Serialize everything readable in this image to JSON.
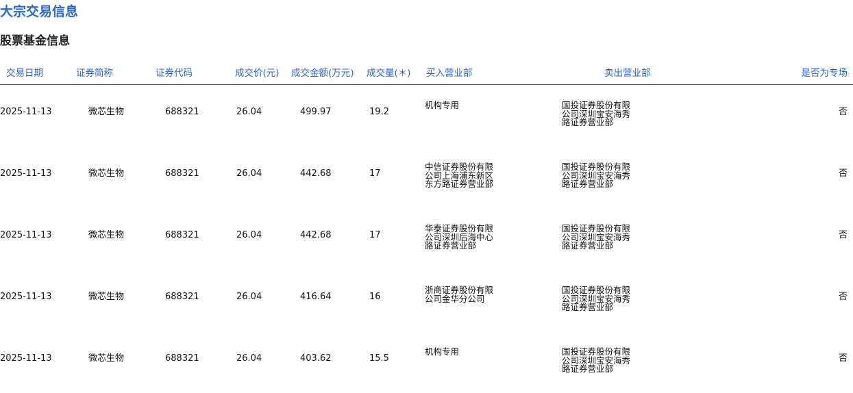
{
  "page": {
    "title": "大宗交易信息",
    "section_title": "股票基金信息"
  },
  "table": {
    "headers": {
      "date": "交易日期",
      "name": "证券简称",
      "code": "证券代码",
      "price": "成交价(元)",
      "amount": "成交金额(万元)",
      "volume": "成交量(＊)",
      "buy": "买入营业部",
      "sell": "卖出营业部",
      "special": "是否为专场"
    },
    "rows": [
      {
        "date": "2025-11-13",
        "name": "微芯生物",
        "code": "688321",
        "price": "26.04",
        "amount": "499.97",
        "volume": "19.2",
        "buy": "机构专用",
        "sell": "国投证券股份有限公司深圳宝安海秀路证券营业部",
        "special": "否"
      },
      {
        "date": "2025-11-13",
        "name": "微芯生物",
        "code": "688321",
        "price": "26.04",
        "amount": "442.68",
        "volume": "17",
        "buy": "中信证券股份有限公司上海浦东新区东方路证券营业部",
        "sell": "国投证券股份有限公司深圳宝安海秀路证券营业部",
        "special": "否"
      },
      {
        "date": "2025-11-13",
        "name": "微芯生物",
        "code": "688321",
        "price": "26.04",
        "amount": "442.68",
        "volume": "17",
        "buy": "华泰证券股份有限公司深圳后海中心路证券营业部",
        "sell": "国投证券股份有限公司深圳宝安海秀路证券营业部",
        "special": "否"
      },
      {
        "date": "2025-11-13",
        "name": "微芯生物",
        "code": "688321",
        "price": "26.04",
        "amount": "416.64",
        "volume": "16",
        "buy": "浙商证券股份有限公司金华分公司",
        "sell": "国投证券股份有限公司深圳宝安海秀路证券营业部",
        "special": "否"
      },
      {
        "date": "2025-11-13",
        "name": "微芯生物",
        "code": "688321",
        "price": "26.04",
        "amount": "403.62",
        "volume": "15.5",
        "buy": "机构专用",
        "sell": "国投证券股份有限公司深圳宝安海秀路证券营业部",
        "special": "否"
      }
    ]
  },
  "colors": {
    "header_text": "#2a66c9",
    "header_border": "#2f6b3a",
    "body_text": "#111111"
  }
}
